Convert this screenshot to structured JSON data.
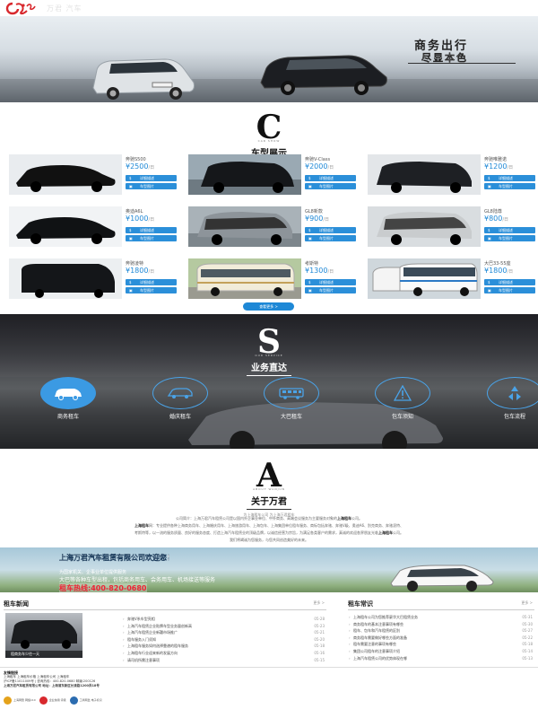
{
  "header": {
    "logo_text": "万君 汽车",
    "brand_name": "万君租车"
  },
  "hero": {
    "slogan_line1": "商务出行",
    "slogan_line2": "尽显本色",
    "plate": "沪A·88888"
  },
  "cars_section": {
    "letter": "C",
    "en": "CAR SHOW",
    "title": "车型展示",
    "more": "查看更多 >"
  },
  "cars": [
    {
      "name": "奔驰S500",
      "price": "¥2500",
      "unit": "/日",
      "btn1": "详细描述",
      "btn2": "车型图片"
    },
    {
      "name": "奔驰V-Class",
      "price": "¥2000",
      "unit": "/日",
      "btn1": "详细描述",
      "btn2": "车型图片"
    },
    {
      "name": "奔驰唯雅诺",
      "price": "¥1200",
      "unit": "/日",
      "btn1": "详细描述",
      "btn2": "车型图片"
    },
    {
      "name": "奥迪A6L",
      "price": "¥1000",
      "unit": "/日",
      "btn1": "详细描述",
      "btn2": "车型图片"
    },
    {
      "name": "GL8新款",
      "price": "¥900",
      "unit": "/日",
      "btn1": "详细描述",
      "btn2": "车型图片"
    },
    {
      "name": "GL8陆尊",
      "price": "¥800",
      "unit": "/日",
      "btn1": "详细描述",
      "btn2": "车型图片"
    },
    {
      "name": "奔驰凌特",
      "price": "¥1800",
      "unit": "/日",
      "btn1": "详细描述",
      "btn2": "车型图片"
    },
    {
      "name": "考斯特",
      "price": "¥1300",
      "unit": "/日",
      "btn1": "详细描述",
      "btn2": "车型图片"
    },
    {
      "name": "大巴33-55座",
      "price": "¥1800",
      "unit": "/日",
      "btn1": "详细描述",
      "btn2": "车型图片"
    }
  ],
  "services_section": {
    "letter": "S",
    "en": "OUR SERVICE",
    "title": "业务直达"
  },
  "services": [
    {
      "label": "商务租车",
      "icon": "car-icon"
    },
    {
      "label": "婚庆租车",
      "icon": "wedding-car-icon"
    },
    {
      "label": "大巴租车",
      "icon": "bus-icon"
    },
    {
      "label": "包车须知",
      "icon": "warning-icon"
    },
    {
      "label": "包车流程",
      "icon": "recycle-icon"
    }
  ],
  "about_section": {
    "letter": "A",
    "en": "ABOUT WANJUN",
    "title": "关于万君",
    "subtitle": "为上海租车公司 为上海万君租车"
  },
  "about": {
    "p1": "公司简介：上海万君汽车租赁公司是以国内外企事业单位、中外商务、高端会议服务为主要服务对象的",
    "p1_bold": "上海租车",
    "p1_end": "公司。",
    "p2_bold": "上海租车",
    "p2": "网：专业提供各种上海商务用车、上海婚庆用车、上海旅游用车、上海包车、上海集团单位租车服务、商标包括奔驰、奔驰V级、奥迪A6、别克商务、奔驰凌特、",
    "p3": "考斯特等，以一流的服务质量、良好的服务态度、打造上海汽车租赁业的顶级品牌，以诚信经营为宗旨，为满足各类客户的需求，真诚的欢迎各界朋友光临",
    "p3_bold": "上海租车",
    "p3_end": "公司。",
    "p4": "我们将竭诚为您服务，与您共同创造美好的未来。"
  },
  "banner": {
    "title": "上海万君汽车租赁有限公司欢迎您!",
    "sub": "为国家机关、企事业单位提供服务",
    "line": "大巴等各种车型出租，包括商务用车、会务用车、机场接送等服务",
    "hotline": "租车热线:400-820-0680"
  },
  "news": {
    "title": "租车新闻",
    "more": "更多 >",
    "pic_caption": "租商务车少往一天",
    "items": [
      {
        "text": "奔驰V系车型亮相",
        "date": "05-28"
      },
      {
        "text": "上海汽车租赁企业贴牌车型业务量创新高",
        "date": "05-23"
      },
      {
        "text": "上海汽车租赁企业新疆市场推广",
        "date": "05-21"
      },
      {
        "text": "租车服务入门须知",
        "date": "05-20"
      },
      {
        "text": "上海租车服务如何选择靠谱的租车服务",
        "date": "05-18"
      },
      {
        "text": "上海租车行业迎来新的发展方向",
        "date": "05-16"
      },
      {
        "text": "请司机所需注意事项",
        "date": "05-15"
      }
    ]
  },
  "knowledge": {
    "title": "租车常识",
    "more": "更多 >",
    "items": [
      {
        "text": "上海租车公司为您推荐豪华大巴租赁业务",
        "date": "05-31"
      },
      {
        "text": "商务租车的基本注意事项有哪些",
        "date": "05-30"
      },
      {
        "text": "租车、包车和汽车租赁的区别",
        "date": "05-27"
      },
      {
        "text": "商务租车需要做好哪些方面的准备",
        "date": "05-22"
      },
      {
        "text": "租车需要注意的事项有哪些",
        "date": "05-18"
      },
      {
        "text": "集团公司租车的注意事项介绍",
        "date": "05-14"
      },
      {
        "text": "上海汽车租赁公司的优势体现在哪",
        "date": "05-13"
      }
    ]
  },
  "footer": {
    "title": "友情链接",
    "line1": "上海租车  上海租车价格  上海租车公司  上海租车",
    "line2": "沪ICP备11011009号  |  咨询热线：400-820-0680  邮编:200126",
    "line3": "上海万君汽车租赁有限公司  地址：上海浦东新区长清路1200弄18号",
    "badge1": "上海网警 网络110",
    "badge2": "企业信用 评级",
    "badge3": "工商网监 电子标识"
  }
}
